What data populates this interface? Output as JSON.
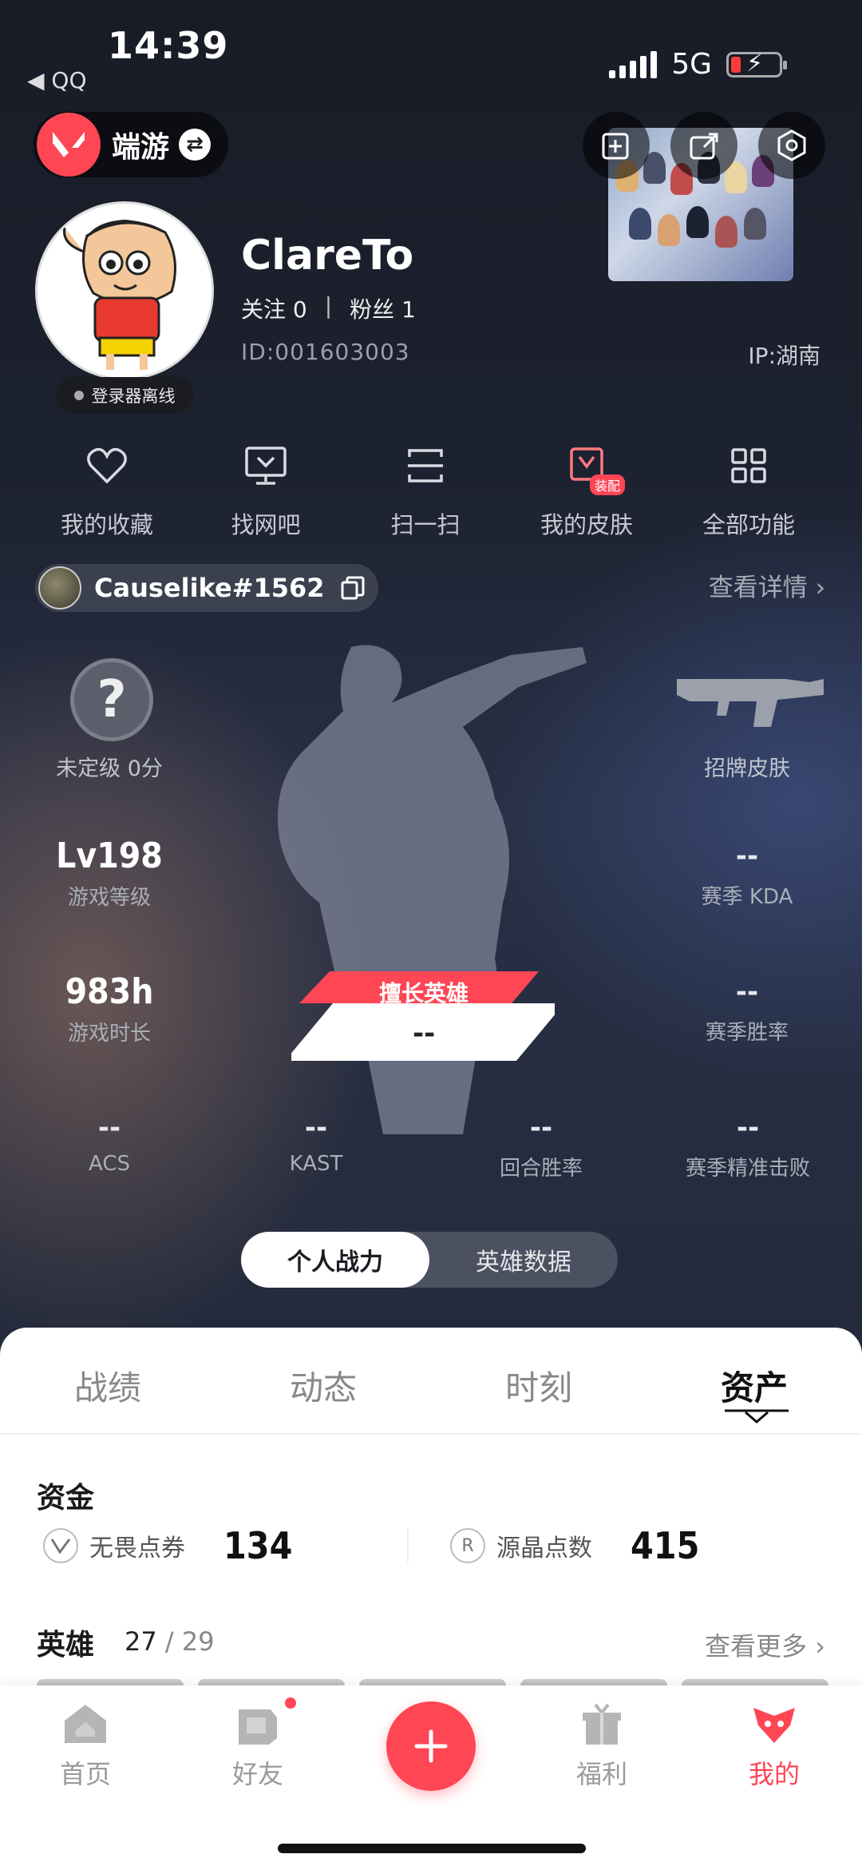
{
  "status_bar": {
    "time": "14:39",
    "back_app": "◀ QQ",
    "network": "5G"
  },
  "header": {
    "game_name": "端游"
  },
  "profile": {
    "username": "ClareTo",
    "follow_label": "关注 0",
    "fans_label": "粉丝 1",
    "separator": "|",
    "id_text": "ID:001603003",
    "ip_text": "IP:湖南",
    "offline_label": "登录器离线"
  },
  "functions": [
    {
      "label": "我的收藏",
      "icon": "heart-icon"
    },
    {
      "label": "找网吧",
      "icon": "monitor-icon"
    },
    {
      "label": "扫一扫",
      "icon": "scan-icon"
    },
    {
      "label": "我的皮肤",
      "icon": "skin-icon",
      "badge": "装配"
    },
    {
      "label": "全部功能",
      "icon": "grid-icon"
    }
  ],
  "riot": {
    "name": "Causelike#1562",
    "detail_label": "查看详情"
  },
  "stats": {
    "rank_label": "未定级 0分",
    "skin_label": "招牌皮肤",
    "level_value": "Lv198",
    "level_label": "游戏等级",
    "kda_value": "--",
    "kda_label": "赛季 KDA",
    "hours_value": "983h",
    "hours_label": "游戏时长",
    "winrate_value": "--",
    "winrate_label": "赛季胜率",
    "best_hero_label": "擅长英雄",
    "best_hero_value": "--",
    "bottom": [
      {
        "value": "--",
        "label": "ACS"
      },
      {
        "value": "--",
        "label": "KAST"
      },
      {
        "value": "--",
        "label": "回合胜率"
      },
      {
        "value": "--",
        "label": "赛季精准击败"
      }
    ]
  },
  "toggle": {
    "active": "个人战力",
    "inactive": "英雄数据"
  },
  "tabs": [
    "战绩",
    "动态",
    "时刻",
    "资产"
  ],
  "assets": {
    "funds_title": "资金",
    "vp_label": "无畏点券",
    "vp_value": "134",
    "rp_label": "源晶点数",
    "rp_value": "415",
    "heroes_title": "英雄",
    "heroes_owned": "27",
    "heroes_total": "/ 29",
    "more_label": "查看更多"
  },
  "nav": [
    "首页",
    "好友",
    "福利",
    "我的"
  ],
  "colors": {
    "accent": "#ff4655"
  }
}
